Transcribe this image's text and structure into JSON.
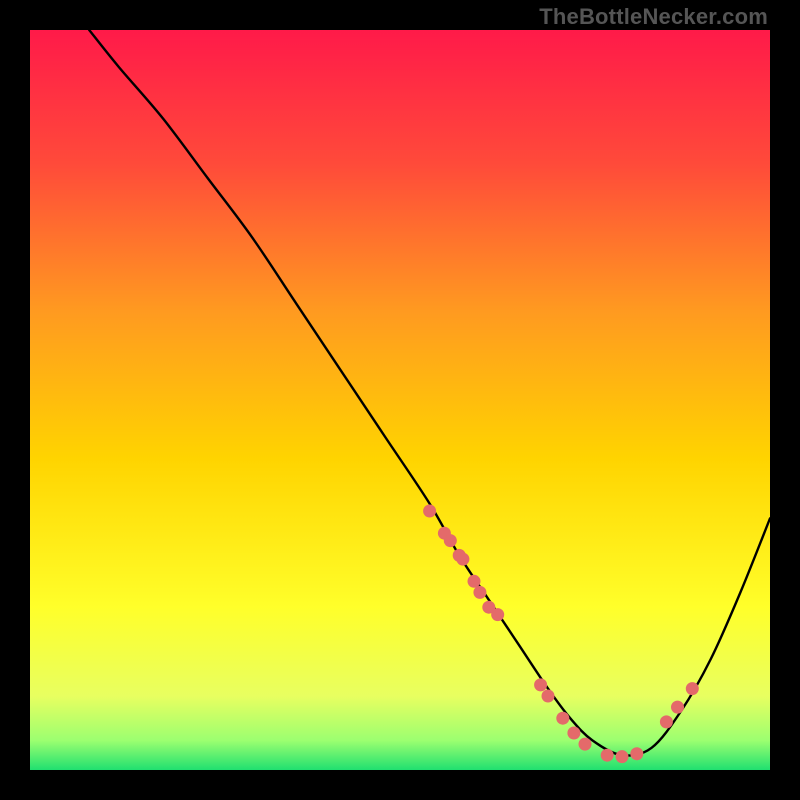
{
  "watermark": "TheBottleNecker.com",
  "gradient": {
    "stops": [
      {
        "offset": "0%",
        "color": "#ff1a49"
      },
      {
        "offset": "18%",
        "color": "#ff4a3a"
      },
      {
        "offset": "38%",
        "color": "#ff9a20"
      },
      {
        "offset": "58%",
        "color": "#ffd400"
      },
      {
        "offset": "78%",
        "color": "#ffff2a"
      },
      {
        "offset": "90%",
        "color": "#e8ff60"
      },
      {
        "offset": "96%",
        "color": "#9cff70"
      },
      {
        "offset": "100%",
        "color": "#20e070"
      }
    ]
  },
  "chart_data": {
    "type": "line",
    "title": "",
    "xlabel": "",
    "ylabel": "",
    "xlim": [
      0,
      100
    ],
    "ylim": [
      0,
      100
    ],
    "series": [
      {
        "name": "curve",
        "x": [
          8,
          12,
          18,
          24,
          30,
          36,
          42,
          48,
          54,
          58,
          62,
          66,
          70,
          73,
          76,
          80,
          84,
          88,
          92,
          96,
          100
        ],
        "y": [
          100,
          95,
          88,
          80,
          72,
          63,
          54,
          45,
          36,
          29,
          23,
          17,
          11,
          7,
          4,
          2,
          3,
          8,
          15,
          24,
          34
        ]
      }
    ],
    "markers": {
      "name": "points",
      "color": "#e46a6a",
      "x": [
        54,
        56,
        56.8,
        58,
        58.5,
        60,
        60.8,
        62,
        63.2,
        69,
        70,
        72,
        73.5,
        75,
        78,
        80,
        82,
        86,
        87.5,
        89.5
      ],
      "y": [
        35,
        32,
        31,
        29,
        28.5,
        25.5,
        24,
        22,
        21,
        11.5,
        10,
        7,
        5,
        3.5,
        2,
        1.8,
        2.2,
        6.5,
        8.5,
        11
      ]
    }
  }
}
